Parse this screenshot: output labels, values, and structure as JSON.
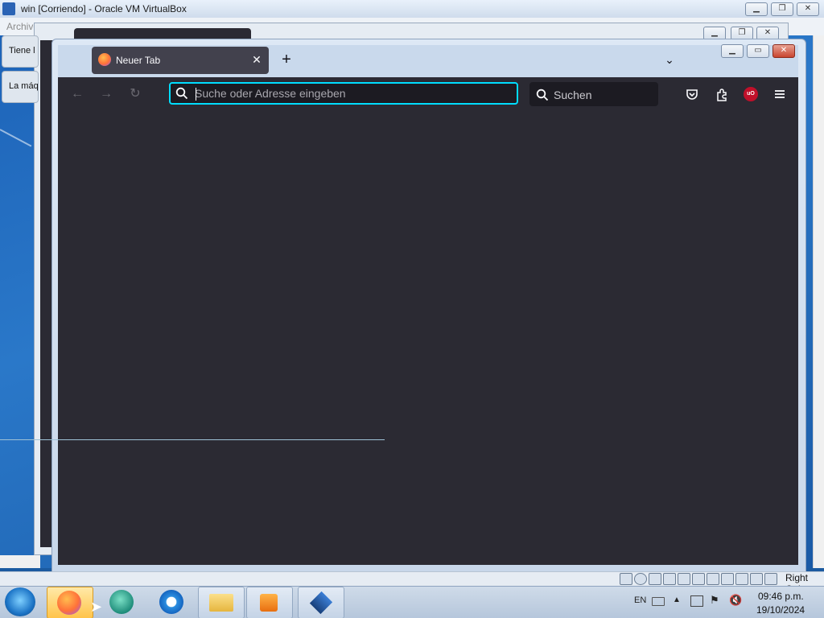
{
  "vbox": {
    "title": "win [Corriendo] - Oracle VM VirtualBox",
    "menu_first": "Archivo",
    "right_ctrl": "Right Ctrl"
  },
  "background_cards": [
    "Tiene l",
    "La máq"
  ],
  "firefox": {
    "tab_title": "Neuer Tab",
    "url_placeholder": "Suche oder Adresse eingeben",
    "search_placeholder": "Suchen",
    "ublock_label": "uO"
  },
  "taskbar": {
    "lang": "EN",
    "time": "09:46 p.m.",
    "date": "19/10/2024"
  },
  "icons": {
    "vbox_app": "virtualbox-icon",
    "firefox": "firefox-icon",
    "ie": "internet-explorer-icon",
    "explorer": "folder-icon",
    "media": "media-player-icon"
  },
  "colors": {
    "ff_dark": "#2b2a33",
    "url_focus": "#00ddff",
    "desktop": "#1b5aa0"
  }
}
